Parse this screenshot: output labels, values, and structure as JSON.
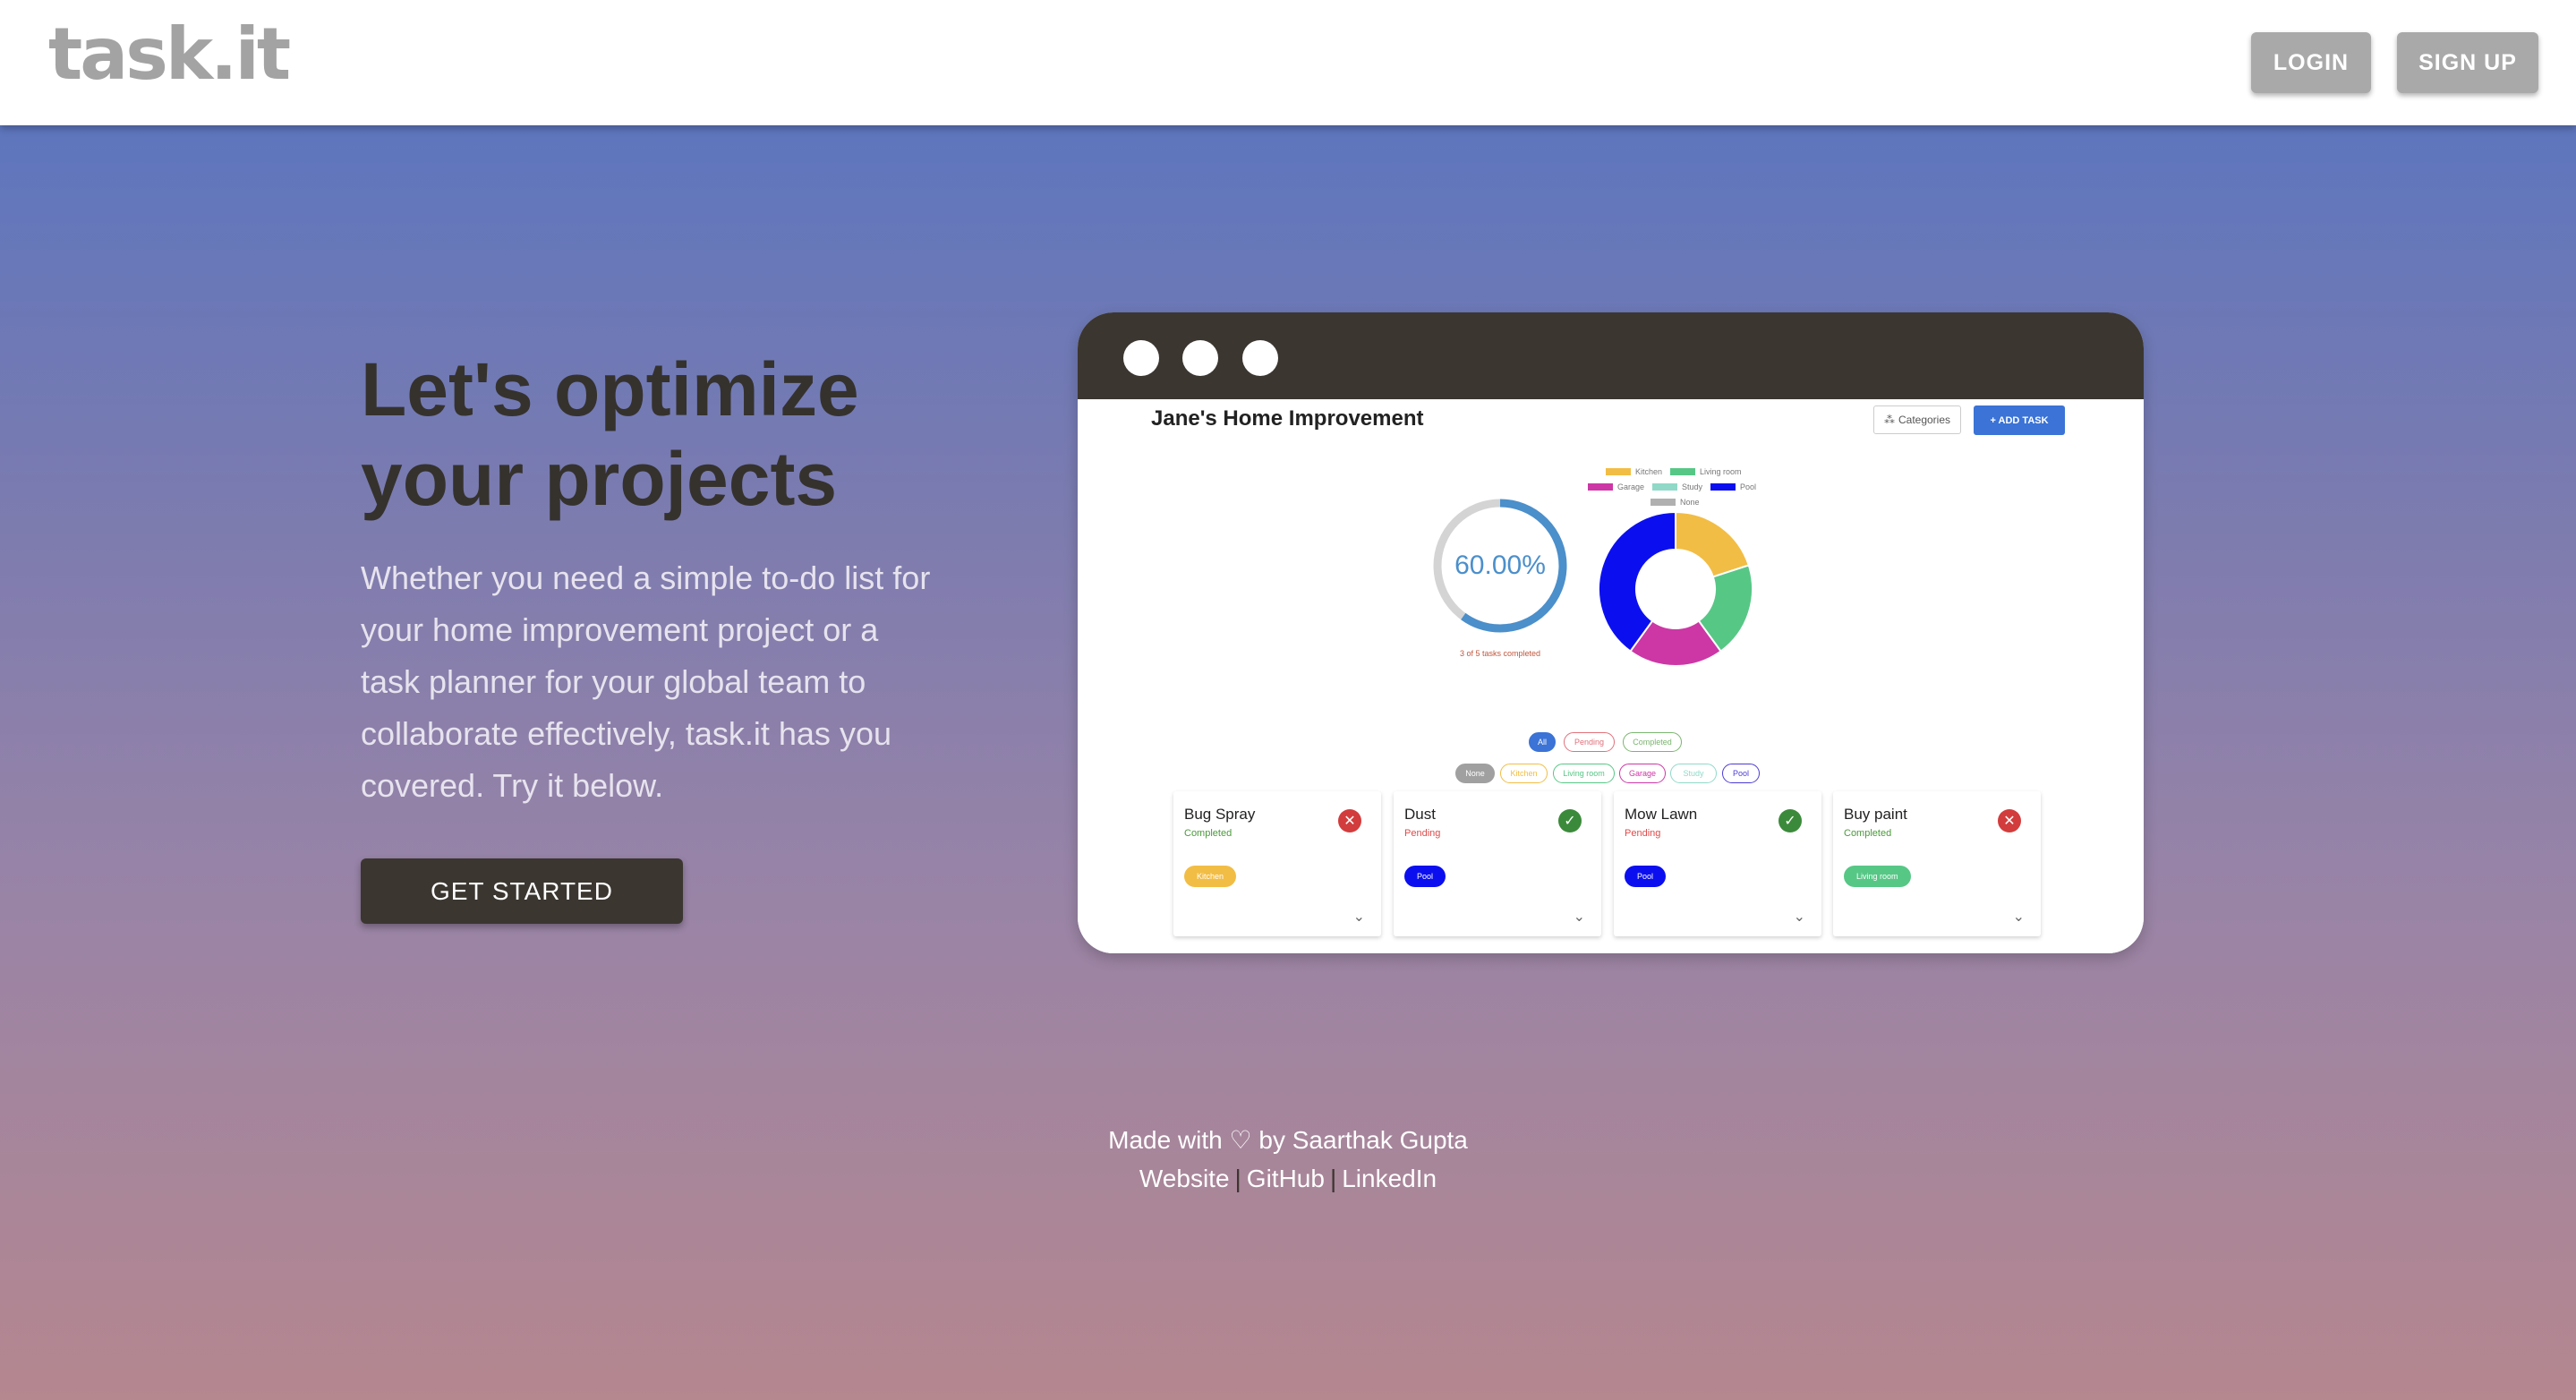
{
  "header": {
    "logo": "task.it",
    "login_label": "LOGIN",
    "signup_label": "SIGN UP"
  },
  "hero": {
    "title": "Let's optimize your projects",
    "description": "Whether you need a simple to-do list for your home improvement project or a task planner for your global team to collaborate effectively, task.it has you covered. Try it below.",
    "cta_label": "GET STARTED"
  },
  "demo": {
    "project_title": "Jane's Home Improvement",
    "categories_label": "Categories",
    "add_task_label": "+ ADD TASK",
    "progress": {
      "percent_label": "60.00%",
      "fraction": 0.6,
      "subtext": "3 of 5 tasks completed"
    },
    "legend": [
      {
        "label": "Kitchen",
        "color": "#f2bd44"
      },
      {
        "label": "Living room",
        "color": "#57c786"
      },
      {
        "label": "Garage",
        "color": "#cc37a5"
      },
      {
        "label": "Study",
        "color": "#90d9c9"
      },
      {
        "label": "Pool",
        "color": "#0b0ff0"
      },
      {
        "label": "None",
        "color": "#b0b0b0"
      }
    ],
    "chart_data": {
      "type": "pie",
      "categories": [
        "Kitchen",
        "Living room",
        "Garage",
        "Pool"
      ],
      "values": [
        1,
        1,
        1,
        2
      ],
      "colors": [
        "#f2bd44",
        "#57c786",
        "#cc37a5",
        "#0b0ff0"
      ]
    },
    "status_filters": [
      {
        "label": "All",
        "color": "#3b73d6"
      },
      {
        "label": "Pending",
        "color": "#e0707a"
      },
      {
        "label": "Completed",
        "color": "#7ab56e"
      }
    ],
    "category_filters": [
      {
        "label": "None",
        "color": "#a0a0a0"
      },
      {
        "label": "Kitchen",
        "color": "#f2bd44"
      },
      {
        "label": "Living room",
        "color": "#57c786"
      },
      {
        "label": "Garage",
        "color": "#cc37a5"
      },
      {
        "label": "Study",
        "color": "#90d9c9"
      },
      {
        "label": "Pool",
        "color": "#4b3bd6"
      }
    ],
    "tasks": [
      {
        "title": "Bug Spray",
        "status": "Completed",
        "status_color": "#4a9a3a",
        "tag": "Kitchen",
        "tag_color": "#f2bd44",
        "icon": "close-icon",
        "icon_color": "#d23c3c"
      },
      {
        "title": "Dust",
        "status": "Pending",
        "status_color": "#e04a4a",
        "tag": "Pool",
        "tag_color": "#0b0ff0",
        "icon": "check-icon",
        "icon_color": "#3b8a3b"
      },
      {
        "title": "Mow Lawn",
        "status": "Pending",
        "status_color": "#e04a4a",
        "tag": "Pool",
        "tag_color": "#0b0ff0",
        "icon": "check-icon",
        "icon_color": "#3b8a3b"
      },
      {
        "title": "Buy paint",
        "status": "Completed",
        "status_color": "#4a9a3a",
        "tag": "Living room",
        "tag_color": "#57c786",
        "icon": "close-icon",
        "icon_color": "#d23c3c"
      }
    ]
  },
  "footer": {
    "made_with": "Made with ♡ by Saarthak Gupta",
    "links": [
      "Website",
      "GitHub",
      "LinkedIn"
    ],
    "separator": "|"
  }
}
